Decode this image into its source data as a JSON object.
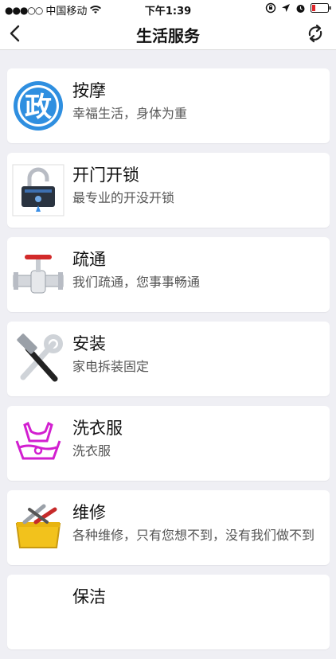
{
  "status_bar": {
    "carrier": "中国移动",
    "time": "下午1:39"
  },
  "nav": {
    "title": "生活服务"
  },
  "services": [
    {
      "title": "按摩",
      "subtitle": "幸福生活，身体为重",
      "icon": "government-zheng-icon",
      "icon_text": "政"
    },
    {
      "title": "开门开锁",
      "subtitle": "最专业的开没开锁",
      "icon": "padlock-icon"
    },
    {
      "title": "疏通",
      "subtitle": "我们疏通，您事事畅通",
      "icon": "pipe-valve-icon"
    },
    {
      "title": "安装",
      "subtitle": "家电拆装固定",
      "icon": "hammer-wrench-icon"
    },
    {
      "title": "洗衣服",
      "subtitle": "洗衣服",
      "icon": "laundry-icon"
    },
    {
      "title": "维修",
      "subtitle": "各种维修，只有您想不到，没有我们做不到",
      "icon": "toolbox-icon"
    },
    {
      "title": "保洁",
      "subtitle": "",
      "icon": "cleaning-icon"
    }
  ],
  "colors": {
    "background": "#efeff4",
    "card": "#ffffff",
    "zheng_blue": "#2f8fe0",
    "laundry_magenta": "#d21fd0"
  }
}
